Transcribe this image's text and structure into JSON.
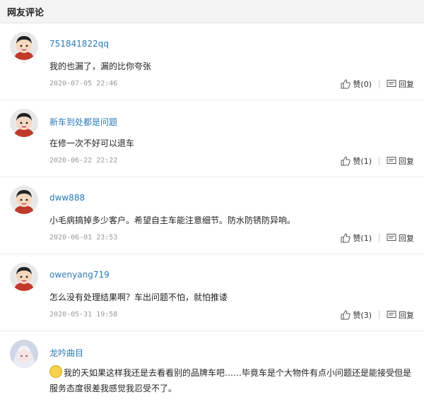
{
  "section_title": "网友评论",
  "like_label": "赞",
  "reply_label": "回复",
  "comments": [
    {
      "user": "751841822qq",
      "text": "我的也漏了，漏的比你夸张",
      "date": "2020-07-05 22:46",
      "likes": "(0)"
    },
    {
      "user": "新车到处都是问题",
      "text": "在修一次不好可以退车",
      "date": "2020-06-22 22:22",
      "likes": "(1)"
    },
    {
      "user": "dww888",
      "text": "小毛病搞掉多少客户。希望自主车能注意细节。防水防锈防异响。",
      "date": "2020-06-01 23:53",
      "likes": "(1)"
    },
    {
      "user": "owenyang719",
      "text": "怎么没有处理结果啊？车出问题不怕，就怕推诿",
      "date": "2020-05-31 19:58",
      "likes": "(3)"
    },
    {
      "user": "龙吟曲目",
      "text": "我的天如果这样我还是去看看别的品牌车吧……毕竟车是个大物件有点小问题还是能接受但是服务态度很差我感觉我忍受不了。"
    }
  ]
}
